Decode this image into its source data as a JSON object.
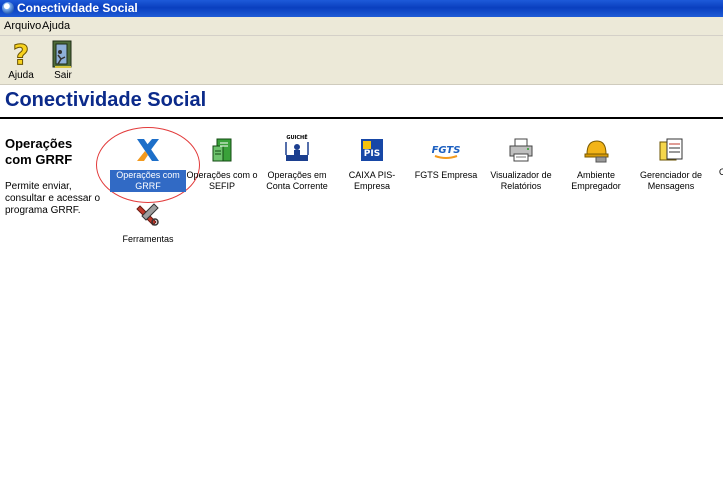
{
  "window": {
    "title": "Conectividade Social"
  },
  "menu": [
    "Arquivo",
    "Ajuda"
  ],
  "toolbar": {
    "help_label": "Ajuda",
    "exit_label": "Sair"
  },
  "page": {
    "heading": "Conectividade Social"
  },
  "selected": {
    "title": "Operações com GRRF",
    "description": "Permite enviar, consultar e acessar o programa GRRF."
  },
  "items": [
    {
      "label": "Operações com GRRF",
      "icon": "caixa-x-icon",
      "selected": true
    },
    {
      "label": "Operações com o SEFIP",
      "icon": "sefip-icon"
    },
    {
      "label": "Operações em Conta Corrente",
      "icon": "guiche-icon",
      "icon_text": "GUICHÊ"
    },
    {
      "label": "CAIXA PIS-Empresa",
      "icon": "pis-icon",
      "icon_text": "PIS"
    },
    {
      "label": "FGTS Empresa",
      "icon": "fgts-icon",
      "icon_text": "FGTS"
    },
    {
      "label": "Visualizador de Relatórios",
      "icon": "printer-icon"
    },
    {
      "label": "Ambiente Empregador",
      "icon": "helmet-icon"
    },
    {
      "label": "Gerenciador de Mensagens",
      "icon": "message-icon"
    },
    {
      "label": "Ferramentas",
      "icon": "tools-icon"
    }
  ],
  "colors": {
    "titlebar": "#0a3fbf",
    "heading": "#0b2a8a",
    "selection": "#316ac5",
    "highlight_ring": "#e23b3b"
  }
}
